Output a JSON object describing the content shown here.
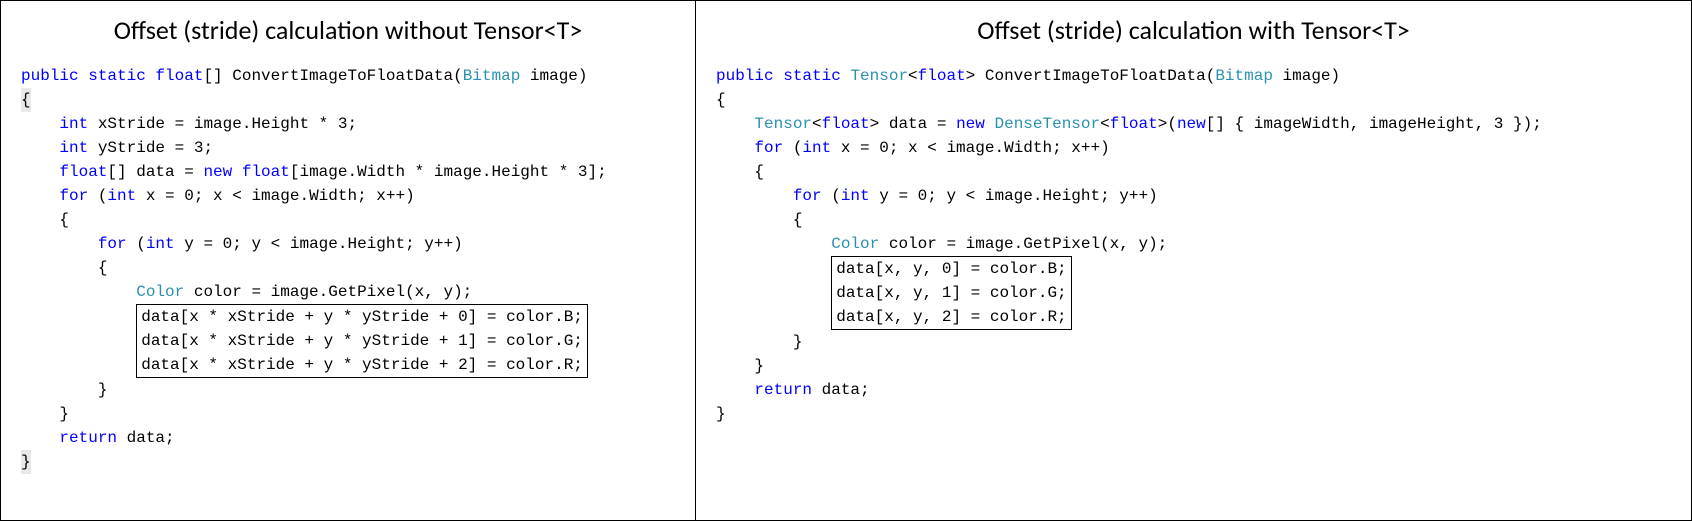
{
  "left": {
    "title": "Offset (stride) calculation without Tensor<T>",
    "sig_pre": "public static float",
    "sig_mid": "[] ConvertImageToFloatData(",
    "sig_type": "Bitmap",
    "sig_post": " image)",
    "l_xStride_kw": "int",
    "l_xStride_rest": " xStride = image.Height * 3;",
    "l_yStride_kw": "int",
    "l_yStride_rest": " yStride = 3;",
    "l_data_kw1": "float",
    "l_data_mid1": "[] data = ",
    "l_data_kw2": "new float",
    "l_data_mid2": "[image.Width * image.Height * 3];",
    "l_forx_kw": "for",
    "l_forx_open": " (",
    "l_forx_int": "int",
    "l_forx_rest": " x = 0; x < image.Width; x++)",
    "l_fory_kw": "for",
    "l_fory_open": " (",
    "l_fory_int": "int",
    "l_fory_rest": " y = 0; y < image.Height; y++)",
    "l_color_type": "Color",
    "l_color_rest": " color = image.GetPixel(x, y);",
    "box1": "data[x * xStride + y * yStride + 0] = color.B;",
    "box2": "data[x * xStride + y * yStride + 1] = color.G;",
    "box3": "data[x * xStride + y * yStride + 2] = color.R;",
    "ret_kw": "return",
    "ret_rest": " data;"
  },
  "right": {
    "title": "Offset (stride) calculation with Tensor<T>",
    "sig_kw": "public static",
    "sig_type1": "Tensor",
    "sig_gen_open": "<",
    "sig_float": "float",
    "sig_gen_close": "> ConvertImageToFloatData(",
    "sig_type2": "Bitmap",
    "sig_post": " image)",
    "r_data_type1": "Tensor",
    "r_data_mid1": "<",
    "r_data_float1": "float",
    "r_data_mid2": "> data = ",
    "r_data_kw_new": "new",
    "r_data_sp": " ",
    "r_data_type2": "DenseTensor",
    "r_data_mid3": "<",
    "r_data_float2": "float",
    "r_data_mid4": ">(",
    "r_data_kw_new2": "new",
    "r_data_rest": "[] { imageWidth, imageHeight, 3 });",
    "r_forx_kw": "for",
    "r_forx_open": " (",
    "r_forx_int": "int",
    "r_forx_rest": " x = 0; x < image.Width; x++)",
    "r_fory_kw": "for",
    "r_fory_open": " (",
    "r_fory_int": "int",
    "r_fory_rest": " y = 0; y < image.Height; y++)",
    "r_color_type": "Color",
    "r_color_rest": " color = image.GetPixel(x, y);",
    "rbox1": "data[x, y, 0] = color.B;",
    "rbox2": "data[x, y, 1] = color.G;",
    "rbox3": "data[x, y, 2] = color.R;",
    "rret_kw": "return",
    "rret_rest": " data;"
  }
}
